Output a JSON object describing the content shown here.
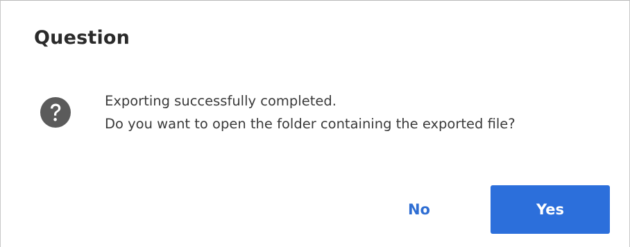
{
  "dialog": {
    "title": "Question",
    "icon": "question-circle-icon",
    "message_lines": [
      "Exporting successfully completed.",
      "Do you want to open the folder containing the exported file?"
    ],
    "buttons": {
      "no_label": "No",
      "yes_label": "Yes"
    }
  },
  "colors": {
    "primary": "#2c6fdb",
    "icon": "#5b5b5b",
    "title_text": "#2a2a2a",
    "body_text": "#3a3a3a"
  }
}
